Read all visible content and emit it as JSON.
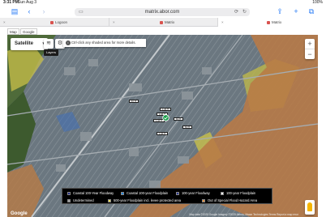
{
  "status": {
    "time": "3:31 PM",
    "date": "Sun Aug 3",
    "battery": "100%"
  },
  "browser": {
    "url": "matrix.abor.com",
    "url_host_icon": "lock-icon"
  },
  "tabs": [
    {
      "label": "Logoon"
    },
    {
      "label": "Matrix"
    },
    {
      "label": "Matrix"
    }
  ],
  "view_tabs": {
    "map": "Map",
    "street": "Google Street View"
  },
  "map": {
    "map_type": "Satellite",
    "layers_tooltip": "Layers",
    "hint": "Ctrl-click any shaded area for more details.",
    "parcels": [
      {
        "label": "67 ft"
      },
      {
        "label": "134 ft"
      },
      {
        "label": "134 ft"
      },
      {
        "label": "50 ft"
      },
      {
        "label": "134 ft"
      },
      {
        "label": "50 ft"
      },
      {
        "label": "134 ft"
      }
    ],
    "legend": [
      {
        "label": "Coastal 100-Year Floodway",
        "color": "#1a237e"
      },
      {
        "label": "Coastal 100-year Floodplain",
        "color": "#1e88e5"
      },
      {
        "label": "100-year Floodway",
        "color": "#283593"
      },
      {
        "label": "100-year Floodplain",
        "color": "#ffffff"
      },
      {
        "label": "Undetermined",
        "color": "#9e9e9e"
      },
      {
        "label": "500-year Floodplain incl. levee protected area",
        "color": "#f4e04d"
      },
      {
        "label": "Out of Special Flood Hazard Area",
        "color": "#e8913a"
      }
    ],
    "attribution": "Map data ©2025 Google Imagery ©2025 Airbus, Maxar Technologies   Terms   Report a map error",
    "google": "Google"
  }
}
